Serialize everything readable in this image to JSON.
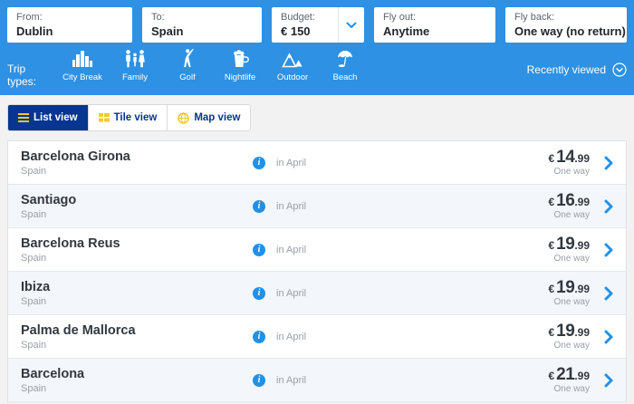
{
  "colors": {
    "header_blue": "#2e91e3",
    "navy": "#073590",
    "yellow": "#f1c933",
    "info_blue": "#2191e8",
    "row_alt_bg": "#f3f6fa"
  },
  "search_form": {
    "from": {
      "label": "From:",
      "value": "Dublin"
    },
    "to": {
      "label": "To:",
      "value": "Spain"
    },
    "budget": {
      "label": "Budget:",
      "value": "€ 150"
    },
    "fly_out": {
      "label": "Fly out:",
      "value": "Anytime"
    },
    "fly_back": {
      "label": "Fly back:",
      "value": "One way (no return)"
    }
  },
  "trip_types": {
    "label": "Trip types:",
    "items": [
      {
        "label": "City Break",
        "icon": "city-break-icon"
      },
      {
        "label": "Family",
        "icon": "family-icon"
      },
      {
        "label": "Golf",
        "icon": "golf-icon"
      },
      {
        "label": "Nightlife",
        "icon": "nightlife-icon"
      },
      {
        "label": "Outdoor",
        "icon": "outdoor-icon"
      },
      {
        "label": "Beach",
        "icon": "beach-icon"
      }
    ],
    "recently_viewed": "Recently viewed"
  },
  "view_tabs": [
    {
      "label": "List view",
      "icon": "list-icon",
      "active": true
    },
    {
      "label": "Tile view",
      "icon": "tile-icon",
      "active": false
    },
    {
      "label": "Map view",
      "icon": "globe-icon",
      "active": false
    }
  ],
  "results": {
    "rows": [
      {
        "city": "Barcelona Girona",
        "country": "Spain",
        "period": "in April",
        "currency": "€",
        "price_whole": "14",
        "price_cents": ".99",
        "fare_type": "One way"
      },
      {
        "city": "Santiago",
        "country": "Spain",
        "period": "in April",
        "currency": "€",
        "price_whole": "16",
        "price_cents": ".99",
        "fare_type": "One way"
      },
      {
        "city": "Barcelona Reus",
        "country": "Spain",
        "period": "in April",
        "currency": "€",
        "price_whole": "19",
        "price_cents": ".99",
        "fare_type": "One way"
      },
      {
        "city": "Ibiza",
        "country": "Spain",
        "period": "in April",
        "currency": "€",
        "price_whole": "19",
        "price_cents": ".99",
        "fare_type": "One way"
      },
      {
        "city": "Palma de Mallorca",
        "country": "Spain",
        "period": "in April",
        "currency": "€",
        "price_whole": "19",
        "price_cents": ".99",
        "fare_type": "One way"
      },
      {
        "city": "Barcelona",
        "country": "Spain",
        "period": "in April",
        "currency": "€",
        "price_whole": "21",
        "price_cents": ".99",
        "fare_type": "One way"
      }
    ]
  }
}
